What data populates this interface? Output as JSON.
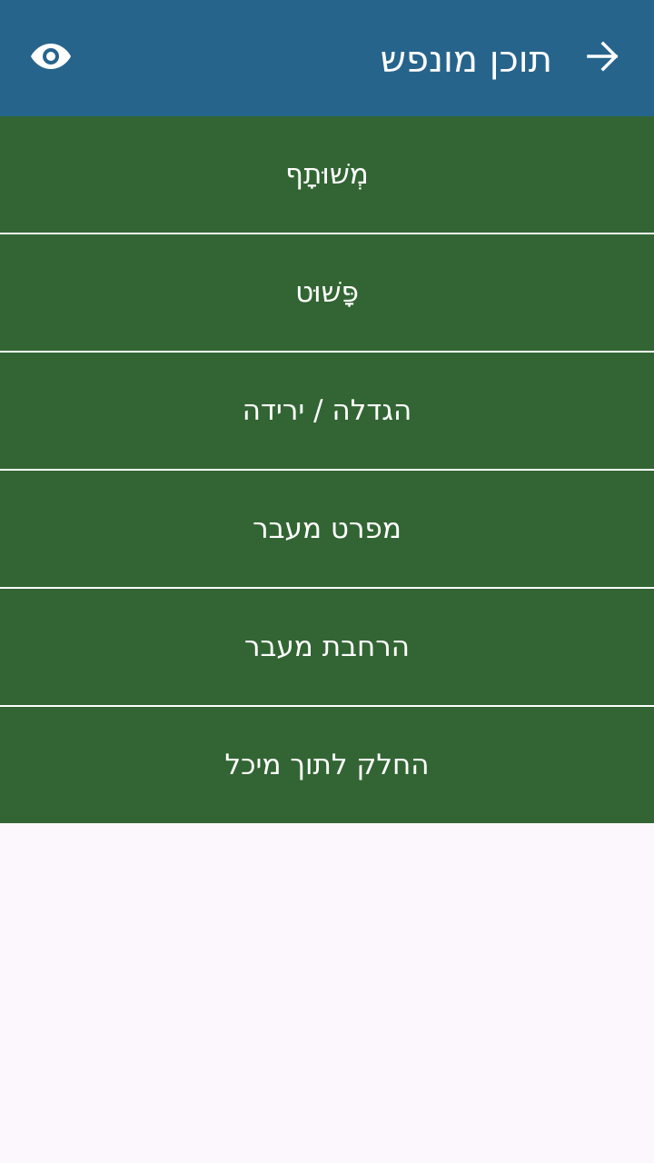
{
  "app_bar": {
    "title": "תוכן מונפש",
    "back_icon": "arrow-right-icon",
    "visibility_icon": "eye-icon",
    "background_color": "#27648c"
  },
  "menu": {
    "background_color": "#326533",
    "items": [
      {
        "label": "מְשׁוּתָף"
      },
      {
        "label": "פָּשׁוּט"
      },
      {
        "label": "הגדלה / ירידה"
      },
      {
        "label": "מפרט מעבר"
      },
      {
        "label": "הרחבת מעבר"
      },
      {
        "label": "החלק לתוך מיכל"
      }
    ]
  }
}
